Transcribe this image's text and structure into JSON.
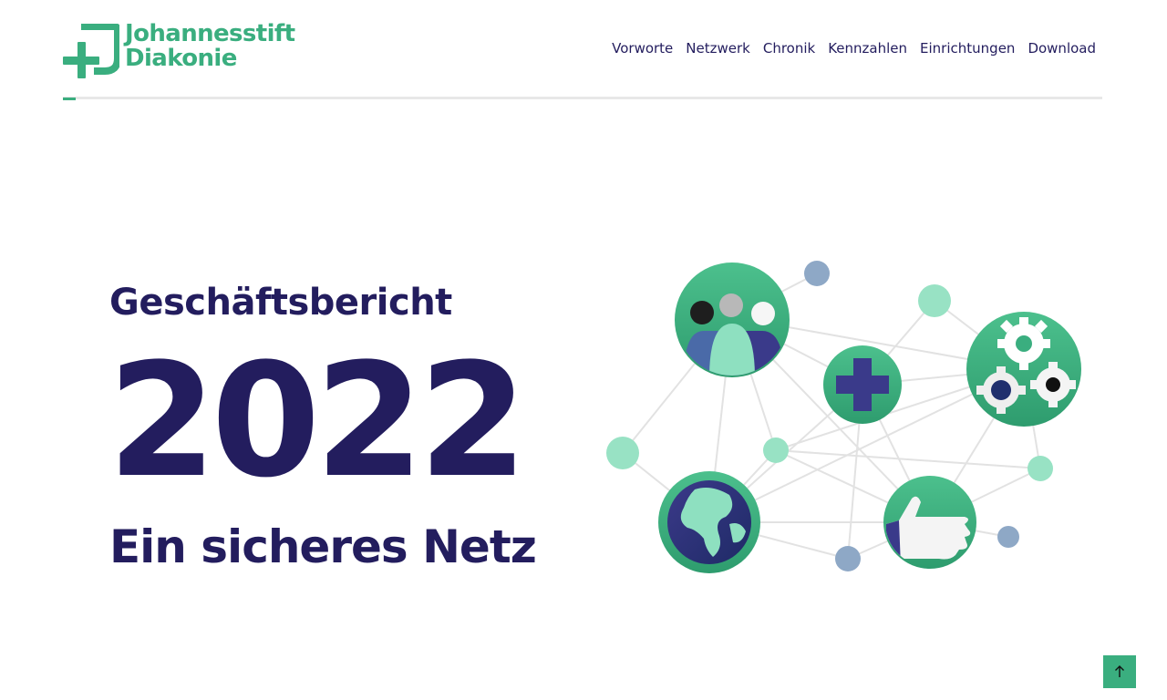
{
  "brand": {
    "name_line1": "Johannesstift",
    "name_line2": "Diakonie",
    "color": "#3aae7f"
  },
  "nav": {
    "items": [
      {
        "label": "Vorworte"
      },
      {
        "label": "Netzwerk"
      },
      {
        "label": "Chronik"
      },
      {
        "label": "Kennzahlen"
      },
      {
        "label": "Einrichtungen"
      },
      {
        "label": "Download"
      }
    ]
  },
  "hero": {
    "subtitle": "Geschäftsbericht",
    "year": "2022",
    "tagline": "Ein sicheres Netz",
    "text_color": "#231d5e"
  },
  "illustration": {
    "icons": [
      "people-icon",
      "cross-icon",
      "gears-icon",
      "globe-icon",
      "hand-icon"
    ]
  },
  "back_to_top": {
    "icon": "arrow-up-icon"
  }
}
